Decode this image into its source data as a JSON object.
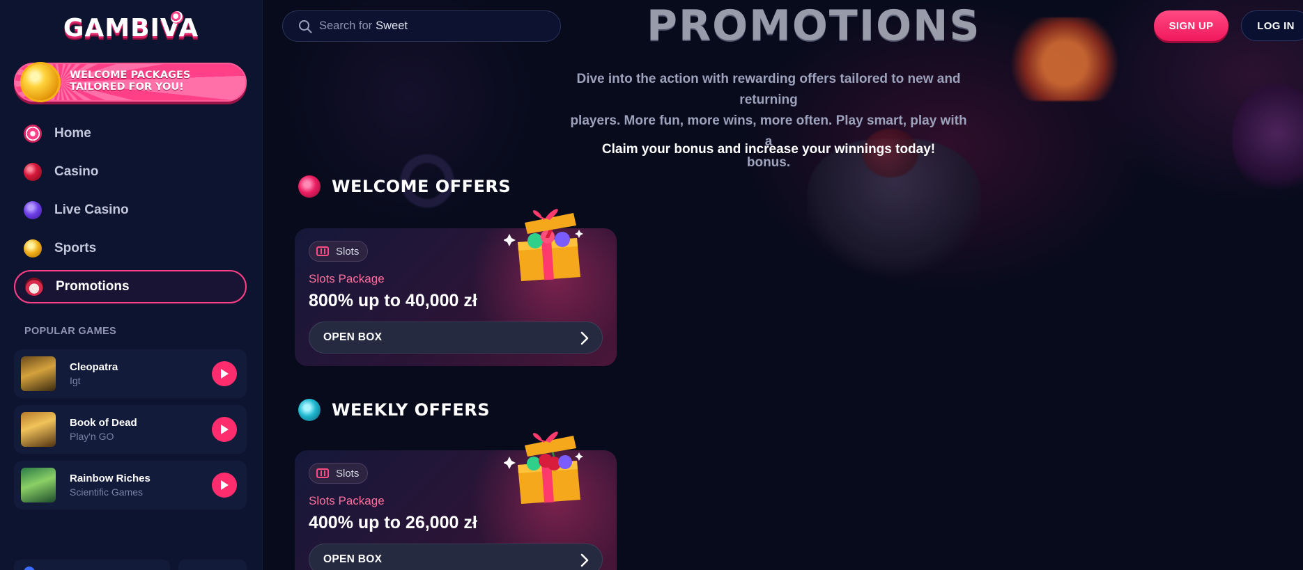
{
  "brand": {
    "logo_text": "GAMBIVA"
  },
  "welcome_banner": {
    "line1": "WELCOME PACKAGES",
    "line2": "TAILORED FOR YOU!"
  },
  "nav": {
    "items": [
      {
        "label": "Home",
        "icon": "lollipop-icon",
        "active": false
      },
      {
        "label": "Casino",
        "icon": "cherry-icon",
        "active": false
      },
      {
        "label": "Live Casino",
        "icon": "chip-icon",
        "active": false
      },
      {
        "label": "Sports",
        "icon": "medal-icon",
        "active": false
      },
      {
        "label": "Promotions",
        "icon": "cupcake-icon",
        "active": true
      }
    ]
  },
  "popular_games": {
    "title": "POPULAR GAMES",
    "items": [
      {
        "name": "Cleopatra",
        "provider": "Igt"
      },
      {
        "name": "Book of Dead",
        "provider": "Play'n GO"
      },
      {
        "name": "Rainbow Riches",
        "provider": "Scientific Games"
      }
    ]
  },
  "search": {
    "prefix": "Search for",
    "term": "Sweet"
  },
  "header": {
    "title": "PROMOTIONS",
    "signup_label": "SIGN UP",
    "login_label": "LOG IN"
  },
  "intro": {
    "line1": "Dive into the action with rewarding offers tailored to new and returning",
    "line2": "players. More fun, more wins, more often. Play smart, play with a",
    "line3": "bonus.",
    "claim": "Claim your bonus and increase your winnings today!"
  },
  "sections": [
    {
      "title": "WELCOME OFFERS",
      "icon": "pink-candy-icon",
      "offer": {
        "tag": "Slots",
        "package_label": "Slots Package",
        "amount": "800% up to 40,000 zł",
        "button_label": "OPEN BOX",
        "gift_icon": "gift-box-seven-icon"
      }
    },
    {
      "title": "WEEKLY OFFERS",
      "icon": "cyan-candy-icon",
      "offer": {
        "tag": "Slots",
        "package_label": "Slots Package",
        "amount": "400% up to 26,000 zł",
        "button_label": "OPEN BOX",
        "gift_icon": "gift-box-cherry-icon"
      }
    }
  ],
  "colors": {
    "accent": "#ff2d6e",
    "sidebar_bg": "#0d1430",
    "main_bg": "#080b1c",
    "card_text_pink": "#ff6f9b"
  }
}
